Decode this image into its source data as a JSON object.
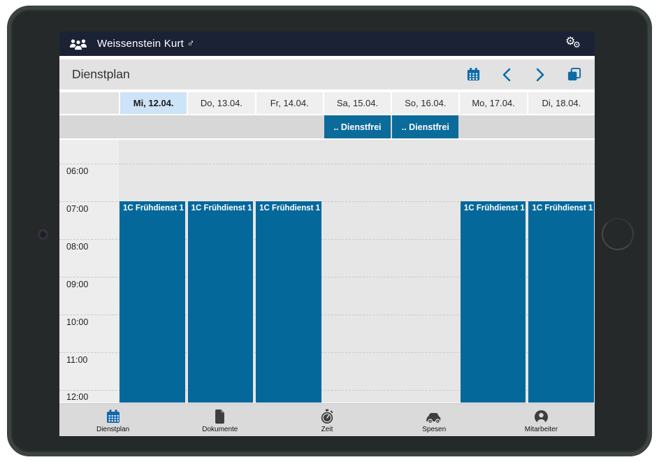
{
  "topbar": {
    "title": "Weissenstein Kurt ♂",
    "group_icon": "group-icon",
    "settings_icon": "gears-icon"
  },
  "toolbar": {
    "title": "Dienstplan",
    "actions": [
      "calendar",
      "previous",
      "next",
      "copy"
    ]
  },
  "calendar": {
    "days": [
      {
        "label": "Mi, 12.04.",
        "active": true
      },
      {
        "label": "Do, 13.04.",
        "active": false
      },
      {
        "label": "Fr, 14.04.",
        "active": false
      },
      {
        "label": "Sa, 15.04.",
        "active": false
      },
      {
        "label": "So, 16.04.",
        "active": false
      },
      {
        "label": "Mo, 17.04.",
        "active": false
      },
      {
        "label": "Di, 18.04.",
        "active": false
      }
    ],
    "allday": [
      {
        "day": 3,
        "label": ".. Dienstfrei"
      },
      {
        "day": 4,
        "label": ".. Dienstfrei"
      }
    ],
    "hours": [
      "06:00",
      "07:00",
      "08:00",
      "09:00",
      "10:00",
      "11:00",
      "12:00"
    ],
    "events": [
      {
        "day": 0,
        "label": "1C Frühdienst 1",
        "start": "07:00"
      },
      {
        "day": 1,
        "label": "1C Frühdienst 1",
        "start": "07:00"
      },
      {
        "day": 2,
        "label": "1C Frühdienst 1",
        "start": "07:00"
      },
      {
        "day": 5,
        "label": "1C Frühdienst 1",
        "start": "07:00"
      },
      {
        "day": 6,
        "label": "1C Frühdienst 1",
        "start": "07:00"
      }
    ]
  },
  "tabbar": {
    "tabs": [
      {
        "label": "Dienstplan",
        "icon": "calendar-icon",
        "active": true
      },
      {
        "label": "Dokumente",
        "icon": "document-icon",
        "active": false
      },
      {
        "label": "Zeit",
        "icon": "stopwatch-icon",
        "active": false
      },
      {
        "label": "Spesen",
        "icon": "car-icon",
        "active": false
      },
      {
        "label": "Mitarbeiter",
        "icon": "person-icon",
        "active": false
      }
    ]
  },
  "colors": {
    "topbar_bg": "#1b2236",
    "accent_blue": "#0e6ba8",
    "event_blue": "#05689b",
    "badge_blue": "#0b6b9a",
    "active_day_bg": "#cde3f8",
    "active_tab_blue": "#1467a8"
  }
}
